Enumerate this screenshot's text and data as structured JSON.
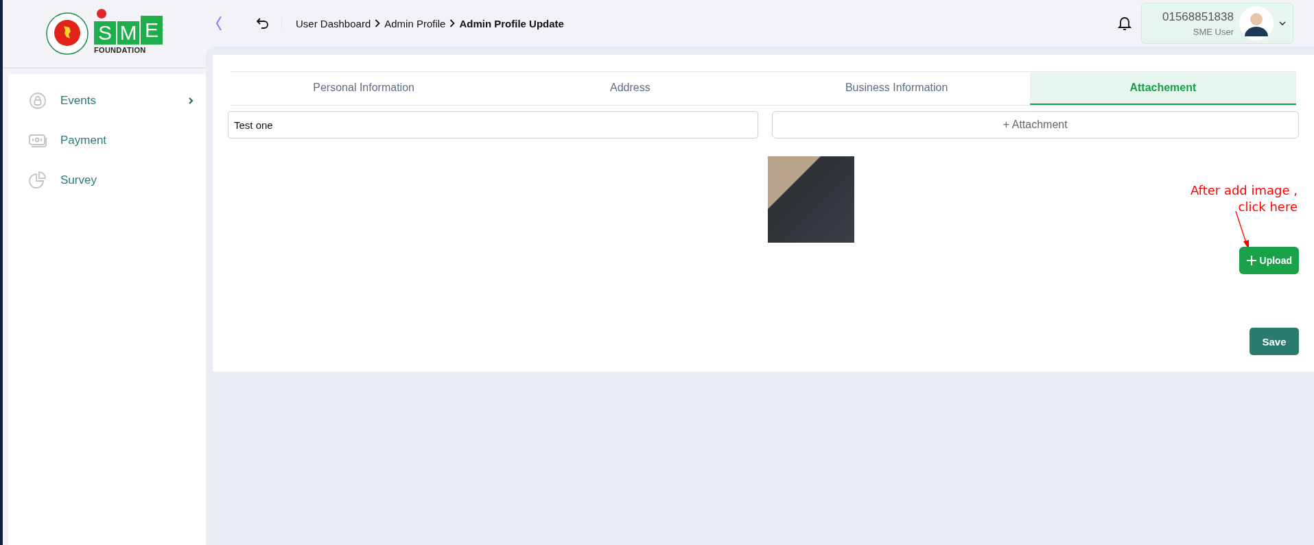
{
  "logo": {
    "wordmark_letters": [
      "S",
      "M",
      "E"
    ],
    "caption": "FOUNDATION"
  },
  "header": {
    "breadcrumb": [
      {
        "label": "User Dashboard",
        "current": false
      },
      {
        "label": "Admin Profile",
        "current": false
      },
      {
        "label": "Admin Profile Update",
        "current": true
      }
    ],
    "user": {
      "phone": "01568851838",
      "role": "SME User"
    }
  },
  "sidebar": {
    "items": [
      {
        "label": "Events",
        "expandable": true
      },
      {
        "label": "Payment",
        "expandable": false
      },
      {
        "label": "Survey",
        "expandable": false
      }
    ]
  },
  "tabs": [
    {
      "label": "Personal Information",
      "selected": false
    },
    {
      "label": "Address",
      "selected": false
    },
    {
      "label": "Business Information",
      "selected": false
    },
    {
      "label": "Attachement",
      "selected": true
    }
  ],
  "form": {
    "title_value": "Test one",
    "attachment_button": "+ Attachment",
    "upload_button": "Upload",
    "save_button": "Save"
  },
  "annotation": {
    "lines": [
      "After add image ,",
      "click here"
    ]
  }
}
